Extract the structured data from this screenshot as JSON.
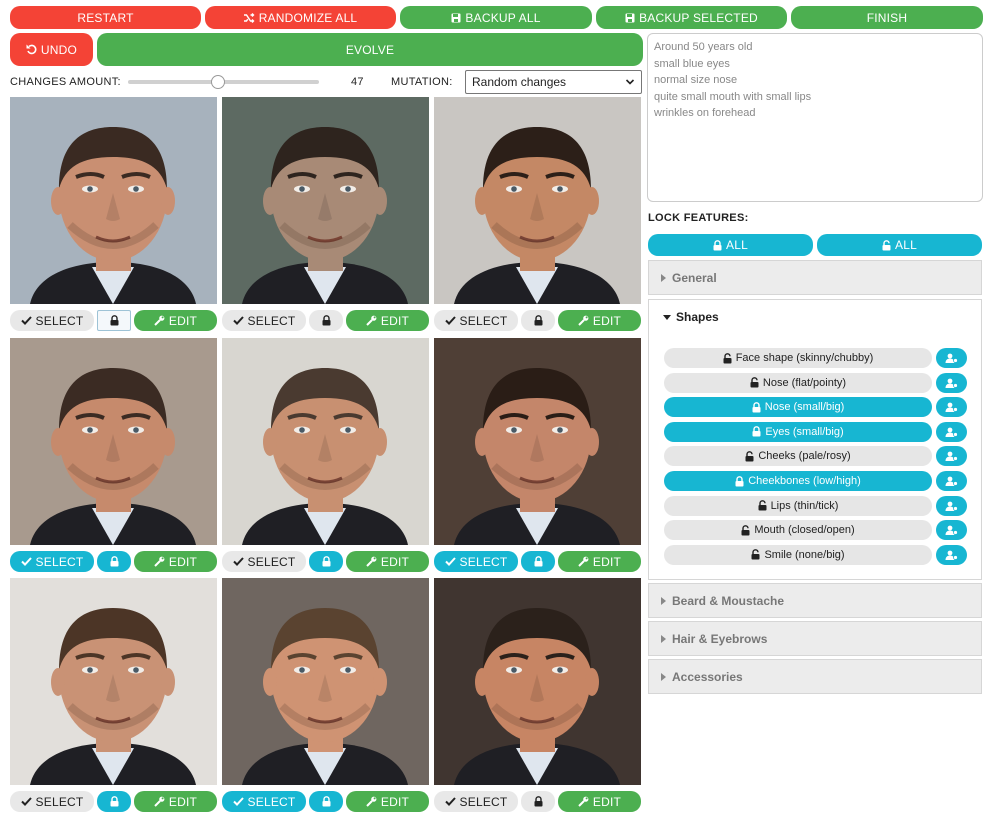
{
  "toolbar": {
    "restart": "RESTART",
    "randomize_all": "RANDOMIZE ALL",
    "backup_all": "BACKUP ALL",
    "backup_selected": "BACKUP SELECTED",
    "finish": "FINISH",
    "undo": "UNDO",
    "evolve": "EVOLVE"
  },
  "controls": {
    "changes_amount_label": "CHANGES AMOUNT:",
    "changes_amount_value": "47",
    "changes_amount_fraction": 0.47,
    "mutation_label": "MUTATION:",
    "mutation_value": "Random changes"
  },
  "card_labels": {
    "select": "SELECT",
    "edit": "EDIT"
  },
  "faces": [
    {
      "selected": false,
      "locked": true,
      "lock_style": "boxed",
      "skin": "#c98f72",
      "bg": "#a7b2bd",
      "hair": "#3a2a22"
    },
    {
      "selected": false,
      "locked": false,
      "lock_style": "gray",
      "skin": "#a88a76",
      "bg": "#5d6a62",
      "hair": "#2e241e"
    },
    {
      "selected": false,
      "locked": false,
      "lock_style": "gray",
      "skin": "#c48865",
      "bg": "#c9c6c2",
      "hair": "#2c1f18"
    },
    {
      "selected": true,
      "locked": true,
      "lock_style": "cyan",
      "skin": "#c68a6c",
      "bg": "#a89a8e",
      "hair": "#3b2b23"
    },
    {
      "selected": false,
      "locked": true,
      "lock_style": "cyan",
      "skin": "#c89071",
      "bg": "#d8d6d0",
      "hair": "#4a3a30"
    },
    {
      "selected": true,
      "locked": true,
      "lock_style": "cyan",
      "skin": "#c4866a",
      "bg": "#4f3f36",
      "hair": "#2a1d16"
    },
    {
      "selected": false,
      "locked": true,
      "lock_style": "cyan",
      "skin": "#c99275",
      "bg": "#e2dfdb",
      "hair": "#4c3526"
    },
    {
      "selected": true,
      "locked": true,
      "lock_style": "cyan",
      "skin": "#cf9373",
      "bg": "#6f6660",
      "hair": "#5a4330"
    },
    {
      "selected": false,
      "locked": false,
      "lock_style": "gray",
      "skin": "#c78564",
      "bg": "#403530",
      "hair": "#2b211b"
    }
  ],
  "description": [
    "Around 50 years old",
    "small blue eyes",
    "normal size nose",
    "quite small mouth with small lips",
    "wrinkles on forehead"
  ],
  "lock_features": {
    "title": "LOCK FEATURES:",
    "lock_all": "ALL",
    "unlock_all": "ALL"
  },
  "accordions": {
    "general": "General",
    "shapes": "Shapes",
    "beard": "Beard & Moustache",
    "hair": "Hair & Eyebrows",
    "accessories": "Accessories"
  },
  "shape_features": [
    {
      "label": "Face shape (skinny/chubby)",
      "locked": false
    },
    {
      "label": "Nose (flat/pointy)",
      "locked": false
    },
    {
      "label": "Nose (small/big)",
      "locked": true
    },
    {
      "label": "Eyes (small/big)",
      "locked": true
    },
    {
      "label": "Cheeks (pale/rosy)",
      "locked": false
    },
    {
      "label": "Cheekbones (low/high)",
      "locked": true
    },
    {
      "label": "Lips (thin/tick)",
      "locked": false
    },
    {
      "label": "Mouth (closed/open)",
      "locked": false
    },
    {
      "label": "Smile (none/big)",
      "locked": false
    }
  ],
  "colors": {
    "red": "#f44336",
    "green": "#4caf50",
    "cyan": "#17b6d2",
    "gray": "#e8e8e8"
  },
  "icons": {
    "randomize": "shuffle-icon",
    "backup": "floppy-disk-icon",
    "undo": "undo-icon",
    "select": "check-icon",
    "edit": "wrench-icon",
    "lock": "lock-icon",
    "unlock": "unlock-icon",
    "profile": "user-cog-icon"
  }
}
